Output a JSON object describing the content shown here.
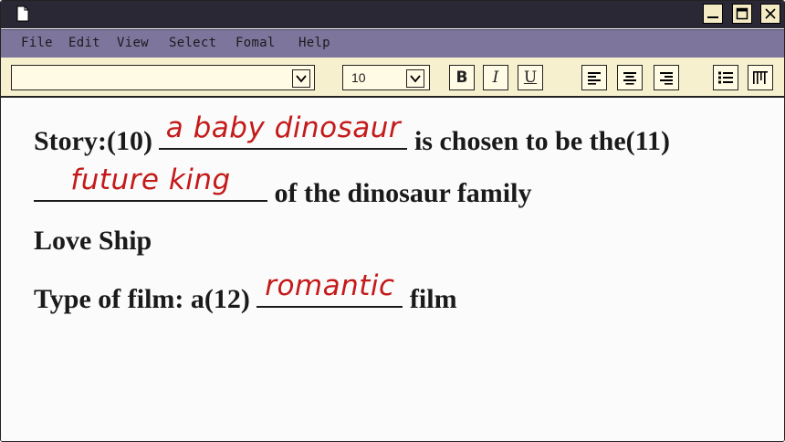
{
  "menu": {
    "items": [
      "File",
      "Edit",
      "View",
      "Select",
      "Fomal",
      "Help"
    ]
  },
  "toolbar": {
    "font_name": "",
    "font_size": "10",
    "bold_label": "B",
    "italic_label": "I",
    "underline_label": "U"
  },
  "document": {
    "line1": {
      "prefix": "Story:(10)",
      "answer": "a baby dinosaur",
      "suffix": "is chosen to be the(11)"
    },
    "line2": {
      "answer": "future king",
      "suffix": "of the dinosaur family"
    },
    "line3": {
      "text": "Love Ship"
    },
    "line4": {
      "prefix": "Type of film: a(12)",
      "answer": "romantic",
      "suffix": "film"
    }
  },
  "colors": {
    "titlebar": "#2b2836",
    "menubar": "#7e759d",
    "toolbar": "#f6f0cf",
    "answer_ink": "#c41a1a"
  }
}
